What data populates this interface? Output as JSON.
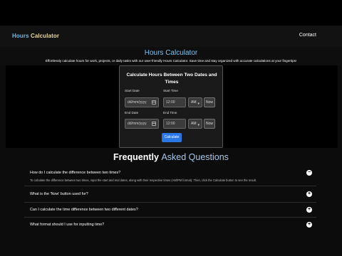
{
  "header": {
    "brand_part1": "Hours ",
    "brand_part2": "Calculator",
    "contact_label": "Contact"
  },
  "hero": {
    "title": "Hours Calculator",
    "subtitle": "Effortlessly calculate hours for work, projects, or daily tasks with our user-friendly Hours Calculator. Save time and stay organized with accurate calculations at your fingertips!"
  },
  "calculator": {
    "title": "Calculate Hours Between Two Dates and Times",
    "start_date_label": "Start Date",
    "start_time_label": "Start Time",
    "end_date_label": "End Date",
    "end_time_label": "End Time",
    "date_placeholder": "dd/mm/yyyy",
    "start_time_value": "12:00",
    "end_time_value": "12:00",
    "start_ampm": "AM",
    "end_ampm": "AM",
    "now_label": "Now",
    "calculate_label": "Calculate",
    "icons": {
      "date": "calendar-icon",
      "dropdown": "chevron-down-icon"
    }
  },
  "faq": {
    "heading_part1": "Frequently",
    "heading_part2": "Asked Questions",
    "items": [
      {
        "question": "How do I calculate the difference between two times?",
        "answer": "To calculate the difference between two times, input the start and end dates, along with their respective times (AM/PM format). Then, click the Calculate button to see the result.",
        "toggle": "−"
      },
      {
        "question": "What is the 'Now' button used for?",
        "toggle": "+"
      },
      {
        "question": "Can I calculate the time difference between two different dates?",
        "toggle": "+"
      },
      {
        "question": "What format should I use for inputting time?",
        "toggle": "+"
      }
    ]
  },
  "colors": {
    "brand_blue": "#6fb7e6",
    "brand_cream": "#e9d9a6",
    "title_blue": "#7ec3ef",
    "button_blue": "#2b78e4",
    "faq_accent": "#a9c8ea",
    "background": "#0c0c0c"
  }
}
